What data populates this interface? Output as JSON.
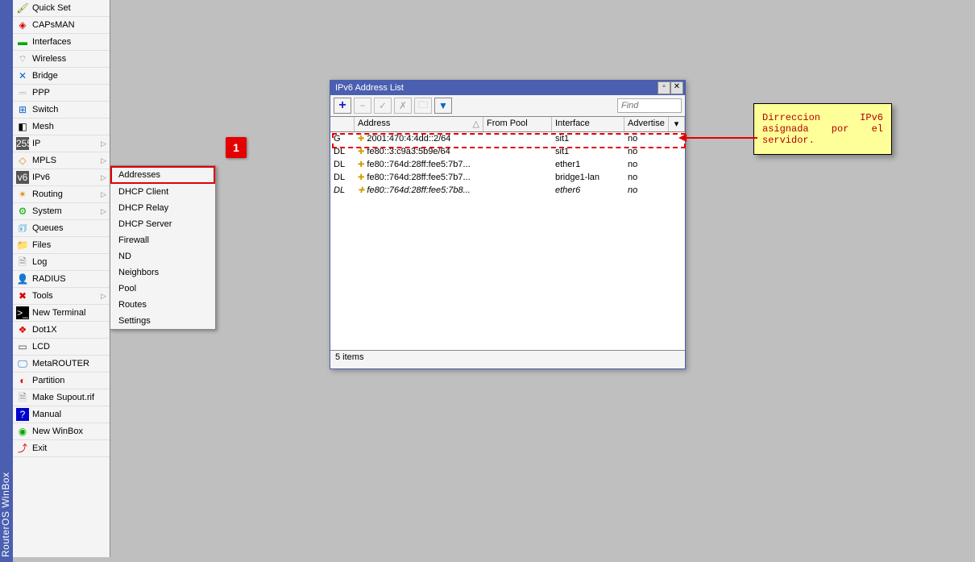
{
  "vertical_title": "RouterOS WinBox",
  "sidebar": [
    {
      "icon": "🖌",
      "cls": "i-qs",
      "label": "Quick Set",
      "arrow": false
    },
    {
      "icon": "◈",
      "cls": "i-cap",
      "label": "CAPsMAN",
      "arrow": false
    },
    {
      "icon": "▬",
      "cls": "i-int",
      "label": "Interfaces",
      "arrow": false
    },
    {
      "icon": "⌔",
      "cls": "i-wl",
      "label": "Wireless",
      "arrow": false
    },
    {
      "icon": "✕",
      "cls": "i-br",
      "label": "Bridge",
      "arrow": false
    },
    {
      "icon": "⎓",
      "cls": "i-ppp",
      "label": "PPP",
      "arrow": false
    },
    {
      "icon": "⊞",
      "cls": "i-sw",
      "label": "Switch",
      "arrow": false
    },
    {
      "icon": "◧",
      "cls": "i-mesh",
      "label": "Mesh",
      "arrow": false
    },
    {
      "icon": "255",
      "cls": "i-ip",
      "label": "IP",
      "arrow": true
    },
    {
      "icon": "◇",
      "cls": "i-mpls",
      "label": "MPLS",
      "arrow": true
    },
    {
      "icon": "v6",
      "cls": "i-ipv6",
      "label": "IPv6",
      "arrow": true
    },
    {
      "icon": "✴",
      "cls": "i-rt",
      "label": "Routing",
      "arrow": true
    },
    {
      "icon": "⚙",
      "cls": "i-sys",
      "label": "System",
      "arrow": true
    },
    {
      "icon": "🗊",
      "cls": "i-q",
      "label": "Queues",
      "arrow": false
    },
    {
      "icon": "📁",
      "cls": "i-fl",
      "label": "Files",
      "arrow": false
    },
    {
      "icon": "🗎",
      "cls": "i-log",
      "label": "Log",
      "arrow": false
    },
    {
      "icon": "👤",
      "cls": "i-rad",
      "label": "RADIUS",
      "arrow": false
    },
    {
      "icon": "✖",
      "cls": "i-tl",
      "label": "Tools",
      "arrow": true
    },
    {
      "icon": ">_",
      "cls": "i-nt",
      "label": "New Terminal",
      "arrow": false
    },
    {
      "icon": "❖",
      "cls": "i-dx",
      "label": "Dot1X",
      "arrow": false
    },
    {
      "icon": "▭",
      "cls": "i-lcd",
      "label": "LCD",
      "arrow": false
    },
    {
      "icon": "🖵",
      "cls": "i-mr",
      "label": "MetaROUTER",
      "arrow": false
    },
    {
      "icon": "◐",
      "cls": "i-pt",
      "label": "Partition",
      "arrow": false
    },
    {
      "icon": "🗎",
      "cls": "i-ms",
      "label": "Make Supout.rif",
      "arrow": false
    },
    {
      "icon": "?",
      "cls": "i-man",
      "label": "Manual",
      "arrow": false
    },
    {
      "icon": "◉",
      "cls": "i-nw",
      "label": "New WinBox",
      "arrow": false
    },
    {
      "icon": "⤴",
      "cls": "i-ex",
      "label": "Exit",
      "arrow": false
    }
  ],
  "submenu": {
    "items": [
      {
        "label": "Addresses",
        "sel": true
      },
      {
        "label": "DHCP Client",
        "sel": false
      },
      {
        "label": "DHCP Relay",
        "sel": false
      },
      {
        "label": "DHCP Server",
        "sel": false
      },
      {
        "label": "Firewall",
        "sel": false
      },
      {
        "label": "ND",
        "sel": false
      },
      {
        "label": "Neighbors",
        "sel": false
      },
      {
        "label": "Pool",
        "sel": false
      },
      {
        "label": "Routes",
        "sel": false
      },
      {
        "label": "Settings",
        "sel": false
      }
    ]
  },
  "badge": "1",
  "window": {
    "title": "IPv6 Address List",
    "find_placeholder": "Find",
    "columns": {
      "flag": "",
      "addr": "Address",
      "pool": "From Pool",
      "ifc": "Interface",
      "adv": "Advertise",
      "drop": "▾"
    },
    "rows": [
      {
        "flag": "G",
        "addr": "2001:470:4:4dd::2/64",
        "pool": "",
        "ifc": "sit1",
        "adv": "no",
        "italic": false
      },
      {
        "flag": "DL",
        "addr": "fe80::3:c9a3:5b9e/64",
        "pool": "",
        "ifc": "sit1",
        "adv": "no",
        "italic": false
      },
      {
        "flag": "DL",
        "addr": "fe80::764d:28ff:fee5:7b7...",
        "pool": "",
        "ifc": "ether1",
        "adv": "no",
        "italic": false
      },
      {
        "flag": "DL",
        "addr": "fe80::764d:28ff:fee5:7b7...",
        "pool": "",
        "ifc": "bridge1-lan",
        "adv": "no",
        "italic": false
      },
      {
        "flag": "DL",
        "addr": "fe80::764d:28ff:fee5:7b8...",
        "pool": "",
        "ifc": "ether6",
        "adv": "no",
        "italic": true
      }
    ],
    "status": "5 items"
  },
  "callout": "Dirreccion IPv6 asignada por el servidor.",
  "toolbar_buttons": {
    "add": "+",
    "remove": "−",
    "enable": "✓",
    "disable": "✗",
    "comment": "🗀",
    "filter": "▼"
  }
}
